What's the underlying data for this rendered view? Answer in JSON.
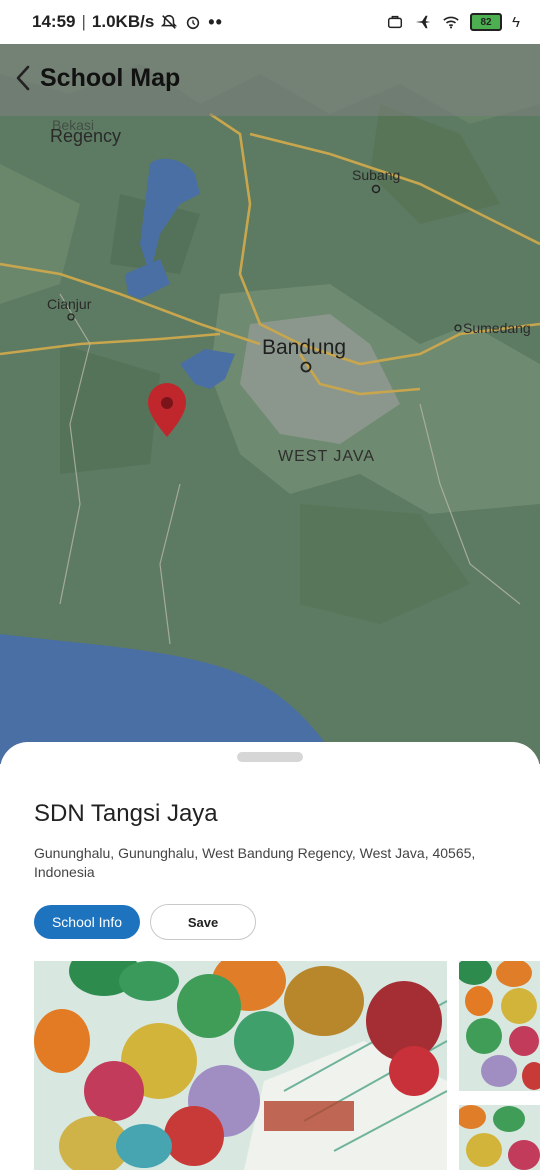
{
  "status_bar": {
    "time": "14:59",
    "network_speed": "1.0KB/s",
    "battery_level": "82",
    "icons": [
      "bell-off-icon",
      "alarm-icon",
      "more-dots-icon",
      "briefcase-icon",
      "airplane-icon",
      "wifi-icon",
      "battery-icon",
      "charging-icon"
    ]
  },
  "app_bar": {
    "title": "School Map",
    "back_icon": "back-arrow-icon"
  },
  "map": {
    "labels": {
      "bekasi_regency": "Regency",
      "bekasi_regency_top": "Bekasi",
      "subang": "Subang",
      "cianjur": "Cianjur",
      "sumedang": "Sumedang",
      "bandung": "Bandung",
      "west_java": "WEST JAVA"
    },
    "marker_icon": "map-pin-icon"
  },
  "sheet": {
    "school_name": "SDN Tangsi Jaya",
    "address": "Gununghalu, Gununghalu, West Bandung Regency, West Java, 40565, Indonesia",
    "info_button": "School Info",
    "save_button": "Save"
  },
  "colors": {
    "primary": "#1e73be",
    "map_land": "#5f7d64",
    "map_water": "#4a6fa5",
    "marker": "#c0272d"
  }
}
